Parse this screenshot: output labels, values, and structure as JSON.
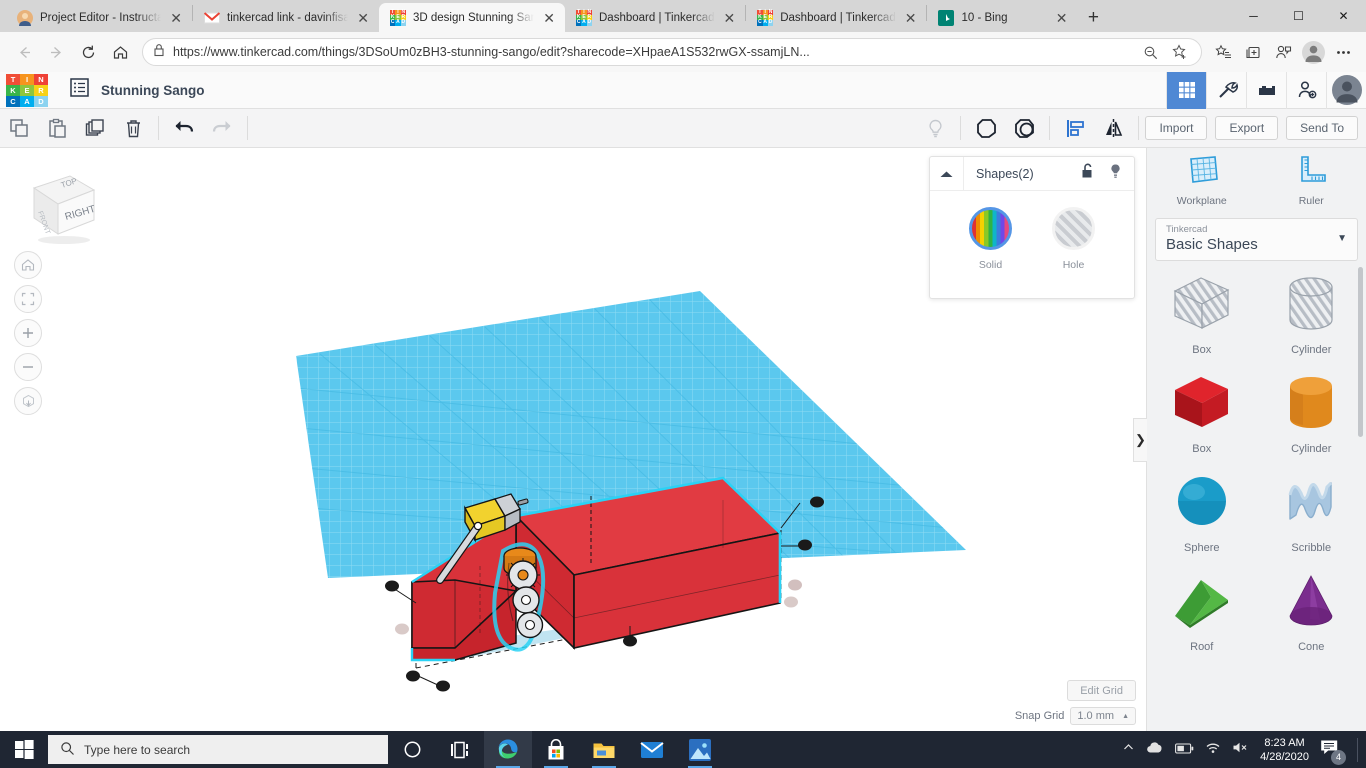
{
  "browser": {
    "tabs": [
      {
        "title": "Project Editor - Instructa",
        "favicon": "user-avatar-icon",
        "active": false
      },
      {
        "title": "tinkercad link - davinfisa",
        "favicon": "gmail-icon",
        "active": false
      },
      {
        "title": "3D design Stunning San",
        "favicon": "tinkercad-icon",
        "active": true
      },
      {
        "title": "Dashboard | Tinkercad",
        "favicon": "tinkercad-icon",
        "active": false
      },
      {
        "title": "Dashboard | Tinkercad",
        "favicon": "tinkercad-icon",
        "active": false
      },
      {
        "title": "10 - Bing",
        "favicon": "bing-icon",
        "active": false
      }
    ],
    "new_tab_label": "+",
    "close_label": "✕",
    "window_controls": {
      "minimize": "─",
      "maximize": "☐",
      "close": "✕"
    },
    "nav": {
      "back": "back-arrow-icon",
      "forward": "forward-arrow-icon",
      "reload": "reload-icon",
      "home": "home-icon"
    },
    "address": {
      "lock": "lock-icon",
      "url": "https://www.tinkercad.com/things/3DSoUm0zBH3-stunning-sango/edit?sharecode=XHpaeA1S532rwGX-ssamjLN...",
      "zoom_out": "zoom-out-icon",
      "favorite": "add-favorite-icon"
    },
    "toolbar_icons": [
      "favorites-list-icon",
      "collections-icon",
      "profile-share-icon",
      "browser-avatar-icon",
      "more-options-icon"
    ]
  },
  "tinkercad": {
    "logo_letters": [
      "T",
      "I",
      "N",
      "K",
      "E",
      "R",
      "C",
      "A",
      "D"
    ],
    "logo_colors": [
      "#f04e37",
      "#f7941e",
      "#ef4136",
      "#39b54a",
      "#8dc63f",
      "#f7d117",
      "#0071bc",
      "#00aeef",
      "#8cd3f0"
    ],
    "project_title": "Stunning Sango",
    "gallery_icon": "list-view-icon",
    "header_icons": [
      {
        "name": "apps-grid-icon",
        "active": true
      },
      {
        "name": "tools-icon",
        "active": false
      },
      {
        "name": "blocks-icon",
        "active": false
      },
      {
        "name": "add-person-icon",
        "active": false
      },
      {
        "name": "user-avatar",
        "active": false
      }
    ],
    "toolbar": {
      "left_tools": [
        {
          "name": "copy-icon",
          "enabled": true
        },
        {
          "name": "paste-icon",
          "enabled": true
        },
        {
          "name": "duplicate-icon",
          "enabled": true
        },
        {
          "name": "delete-icon",
          "enabled": true
        },
        {
          "name": "undo-icon",
          "enabled": true
        },
        {
          "name": "redo-icon",
          "enabled": false
        }
      ],
      "right_tools": [
        {
          "name": "lightbulb-icon",
          "enabled": false
        },
        {
          "name": "group-icon",
          "enabled": true
        },
        {
          "name": "ungroup-icon",
          "enabled": true
        },
        {
          "name": "align-icon",
          "enabled": true
        },
        {
          "name": "mirror-icon",
          "enabled": true
        }
      ],
      "import_label": "Import",
      "export_label": "Export",
      "send_to_label": "Send To"
    },
    "shapes_panel": {
      "collapse_icon": "chevron-up-icon",
      "title": "Shapes(2)",
      "lock_icon": "unlock-icon",
      "bulb_icon": "lightbulb-icon",
      "options": [
        {
          "label": "Solid",
          "type": "solid",
          "selected": true
        },
        {
          "label": "Hole",
          "type": "hole",
          "selected": false
        }
      ]
    },
    "viewcube": {
      "top_face": "TOP",
      "front_face": "FRONT",
      "right_face": "RIGHT"
    },
    "view_buttons": [
      "home-view-icon",
      "fit-all-icon",
      "zoom-in-icon",
      "zoom-out-icon",
      "ortho-perspective-icon"
    ],
    "grid": {
      "edit_grid_label": "Edit Grid",
      "snap_grid_label": "Snap Grid",
      "snap_grid_value": "1.0 mm",
      "snap_caret": "▲"
    },
    "sidebar": {
      "tools": [
        {
          "label": "Workplane",
          "icon": "workplane-icon"
        },
        {
          "label": "Ruler",
          "icon": "ruler-icon"
        }
      ],
      "library_select": {
        "group": "Tinkercad",
        "value": "Basic Shapes",
        "caret": "▼"
      },
      "shapes": [
        {
          "label": "Box",
          "icon": "hole-box-icon",
          "color": "#cfd3d8",
          "kind": "hole-box"
        },
        {
          "label": "Cylinder",
          "icon": "hole-cylinder-icon",
          "color": "#cfd3d8",
          "kind": "hole-cylinder"
        },
        {
          "label": "Box",
          "icon": "box-icon",
          "color": "#cf1b24",
          "kind": "box"
        },
        {
          "label": "Cylinder",
          "icon": "cylinder-icon",
          "color": "#e8891a",
          "kind": "cylinder"
        },
        {
          "label": "Sphere",
          "icon": "sphere-icon",
          "color": "#1799c7",
          "kind": "sphere"
        },
        {
          "label": "Scribble",
          "icon": "scribble-icon",
          "color": "#a8c6e0",
          "kind": "scribble"
        },
        {
          "label": "Roof",
          "icon": "roof-icon",
          "color": "#3d9c35",
          "kind": "roof"
        },
        {
          "label": "Cone",
          "icon": "cone-icon",
          "color": "#7b2d8e",
          "kind": "cone"
        }
      ],
      "panel_toggle": "❯"
    },
    "colors": {
      "workplane": "#5bc8ee",
      "model_red": "#d92d36",
      "accent_blue": "#4f88d4",
      "selection_cyan": "#2ad2f5"
    }
  },
  "taskbar": {
    "start_icon": "windows-start-icon",
    "search_placeholder": "Type here to search",
    "search_icon": "search-icon",
    "apps": [
      {
        "name": "cortana-icon",
        "running": false,
        "active": false
      },
      {
        "name": "task-view-icon",
        "running": false,
        "active": false
      },
      {
        "name": "edge-icon",
        "running": true,
        "active": true
      },
      {
        "name": "microsoft-store-icon",
        "running": true,
        "active": false
      },
      {
        "name": "file-explorer-icon",
        "running": true,
        "active": false
      },
      {
        "name": "mail-icon",
        "running": false,
        "active": false
      },
      {
        "name": "photos-icon",
        "running": true,
        "active": false
      }
    ],
    "tray": {
      "chevron": "show-hidden-icons-icon",
      "cloud": "onedrive-icon",
      "battery": "battery-icon",
      "wifi": "wifi-icon",
      "volume": "volume-muted-icon",
      "time": "8:23 AM",
      "date": "4/28/2020",
      "notification_icon": "action-center-icon",
      "notification_count": "4"
    }
  }
}
